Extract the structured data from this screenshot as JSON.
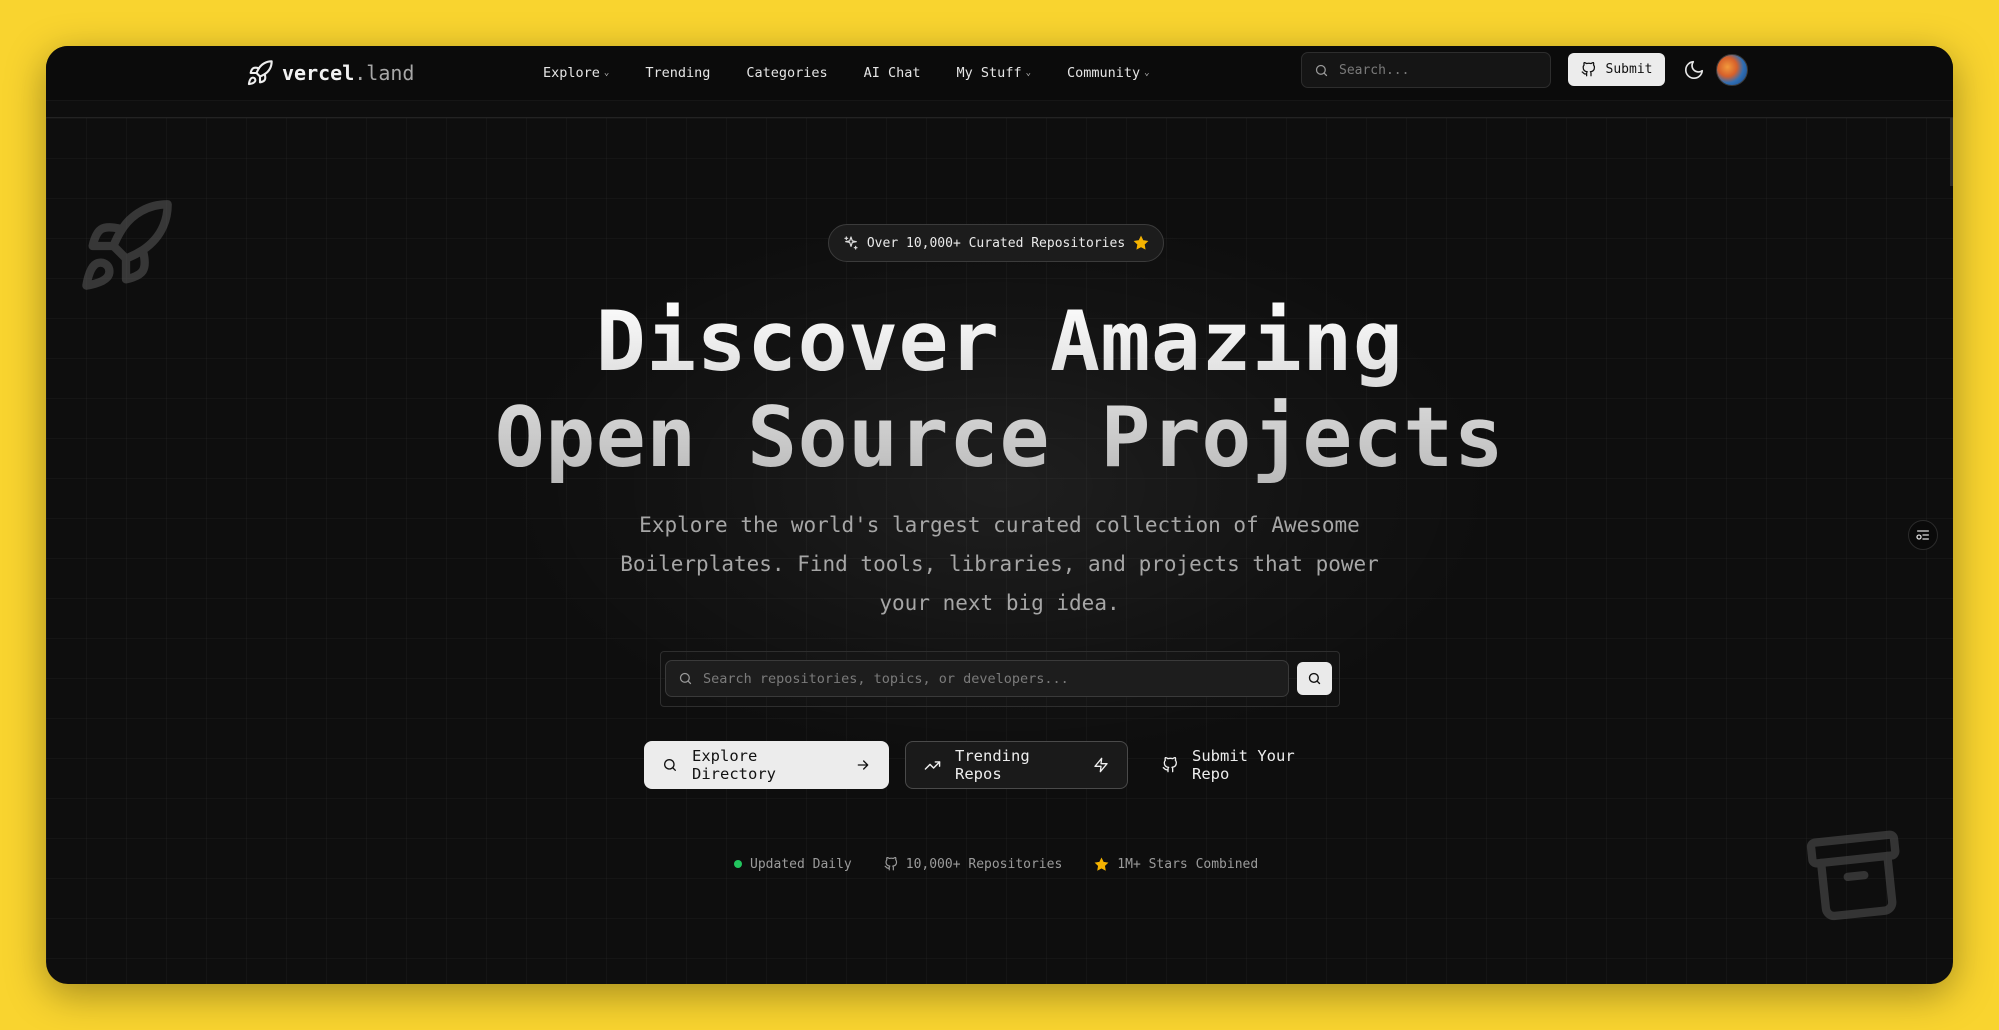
{
  "brand": {
    "name": "vercel",
    "tld": ".land"
  },
  "nav": {
    "links": [
      {
        "label": "Explore",
        "dropdown": true
      },
      {
        "label": "Trending",
        "dropdown": false
      },
      {
        "label": "Categories",
        "dropdown": false
      },
      {
        "label": "AI Chat",
        "dropdown": false
      },
      {
        "label": "My Stuff",
        "dropdown": true
      },
      {
        "label": "Community",
        "dropdown": true
      }
    ],
    "search_placeholder": "Search...",
    "submit_label": "Submit"
  },
  "hero": {
    "badge": "Over 10,000+ Curated Repositories",
    "title_line1": "Discover Amazing",
    "title_line2": "Open Source Projects",
    "subtitle": "Explore the world's largest curated collection of Awesome Boilerplates. Find tools, libraries, and projects that power your next big idea.",
    "search_placeholder": "Search repositories, topics, or developers...",
    "cta_primary": "Explore Directory",
    "cta_secondary": "Trending Repos",
    "cta_ghost": "Submit Your Repo"
  },
  "stats": [
    {
      "label": "Updated Daily",
      "icon": "green-dot"
    },
    {
      "label": "10,000+ Repositories",
      "icon": "github-icon"
    },
    {
      "label": "1M+ Stars Combined",
      "icon": "star-icon"
    }
  ],
  "colors": {
    "page_bg": "#f9d42f",
    "app_bg": "#0e0e0e",
    "accent_star": "#f5b301",
    "status_green": "#22c55e"
  }
}
